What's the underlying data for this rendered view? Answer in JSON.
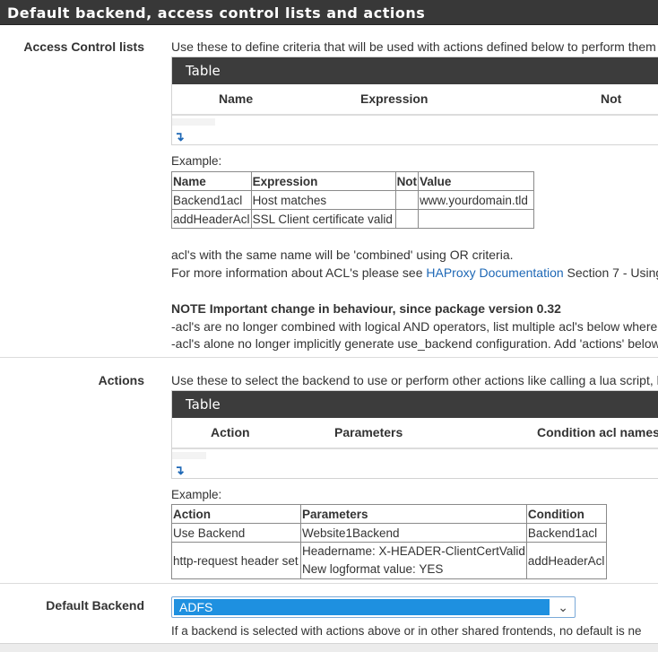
{
  "panel": {
    "title": "Default backend, access control lists and actions"
  },
  "acl": {
    "label": "Access Control lists",
    "description": "Use these to define criteria that will be used with actions defined below to perform them",
    "table_title": "Table",
    "columns": [
      "Name",
      "Expression",
      "Not"
    ],
    "example_label": "Example:",
    "example_headers": [
      "Name",
      "Expression",
      "Not",
      "Value"
    ],
    "example_rows": [
      [
        "Backend1acl",
        "Host matches",
        "",
        "www.yourdomain.tld"
      ],
      [
        "addHeaderAcl",
        "SSL Client certificate valid",
        "",
        ""
      ]
    ],
    "note1": "acl's with the same name will be 'combined' using OR criteria.",
    "note2_prefix": "For more information about ACL's please see ",
    "note2_link": "HAProxy Documentation",
    "note2_suffix": " Section 7 - Using",
    "important_title": "NOTE Important change in behaviour, since package version 0.32",
    "important_line1": "-acl's are no longer combined with logical AND operators, list multiple acl's below where",
    "important_line2": "-acl's alone no longer implicitly generate use_backend configuration. Add 'actions' below"
  },
  "actions": {
    "label": "Actions",
    "description": "Use these to select the backend to use or perform other actions like calling a lua script, l",
    "table_title": "Table",
    "columns": [
      "Action",
      "Parameters",
      "Condition acl names"
    ],
    "example_label": "Example:",
    "example_headers": [
      "Action",
      "Parameters",
      "Condition"
    ],
    "example_rows": [
      {
        "action": "Use Backend",
        "param1": "Website1Backend",
        "param2": "",
        "condition": "Backend1acl"
      },
      {
        "action": "http-request header set",
        "param1": "Headername: X-HEADER-ClientCertValid",
        "param2": "New logformat value: YES",
        "condition": "addHeaderAcl"
      }
    ]
  },
  "default_backend": {
    "label": "Default Backend",
    "selected": "ADFS",
    "help": "If a backend is selected with actions above or in other shared frontends, no default is ne"
  },
  "colors": {
    "accent": "#1e90e0",
    "link": "#1e68b6",
    "header_bg": "#383838"
  }
}
